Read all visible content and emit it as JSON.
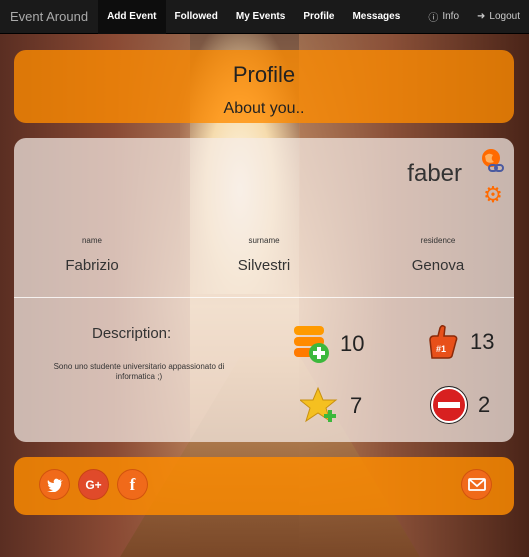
{
  "navbar": {
    "brand": "Event Around",
    "items": [
      "Add Event",
      "Followed",
      "My Events",
      "Profile",
      "Messages"
    ],
    "info": "Info",
    "logout": "Logout"
  },
  "header": {
    "title": "Profile",
    "subtitle": "About you.."
  },
  "profile": {
    "username": "faber",
    "fields": {
      "name": {
        "label": "name",
        "value": "Fabrizio"
      },
      "surname": {
        "label": "surname",
        "value": "Silvestri"
      },
      "residence": {
        "label": "residence",
        "value": "Genova"
      }
    },
    "description_title": "Description:",
    "description_text": "Sono uno studente universitario appassionato di informatica ;)",
    "stats": {
      "events": "10",
      "followers": "13",
      "favorites": "7",
      "blocked": "2"
    }
  },
  "colors": {
    "accent": "#ff8c00",
    "navbar": "#1a1a1a"
  }
}
